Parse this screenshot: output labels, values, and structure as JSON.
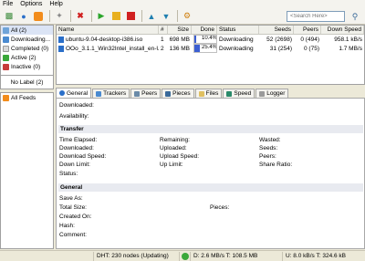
{
  "menu": [
    "File",
    "Options",
    "Help"
  ],
  "search": {
    "placeholder": "<Search Here>"
  },
  "categories": [
    {
      "label": "All (2)"
    },
    {
      "label": "Downloading..."
    },
    {
      "label": "Completed (0)"
    },
    {
      "label": "Active (2)"
    },
    {
      "label": "Inactive (0)"
    }
  ],
  "no_label": "No Label (2)",
  "all_feeds": "All Feeds",
  "columns": [
    "Name",
    "#",
    "Size",
    "Done",
    "Status",
    "Seeds",
    "Peers",
    "Down Speed"
  ],
  "torrents": [
    {
      "name": "ubuntu-9.04-desktop-i386.iso",
      "num": "1",
      "size": "698 MB",
      "done": "10.4%",
      "progress": 0.104,
      "status": "Downloading",
      "seeds": "52 (2698)",
      "peers": "0 (494)",
      "down": "958.1 kB/s"
    },
    {
      "name": "OOo_3.1.1_Win32Intel_install_en-U...",
      "num": "2",
      "size": "136 MB",
      "done": "25.4%",
      "progress": 0.254,
      "status": "Downloading",
      "seeds": "31 (254)",
      "peers": "0 (75)",
      "down": "1.7 MB/s"
    }
  ],
  "tabs": [
    "General",
    "Trackers",
    "Peers",
    "Pieces",
    "Files",
    "Speed",
    "Logger"
  ],
  "general": {
    "downloaded": "Downloaded:",
    "availability": "Availability:",
    "transfer_title": "Transfer",
    "time_elapsed": "Time Elapsed:",
    "remaining": "Remaining:",
    "wasted": "Wasted:",
    "downloaded2": "Downloaded:",
    "uploaded": "Uploaded:",
    "seeds": "Seeds:",
    "download_speed": "Download Speed:",
    "upload_speed": "Upload Speed:",
    "peers": "Peers:",
    "down_limit": "Down Limit:",
    "up_limit": "Up Limit:",
    "share_ratio": "Share Ratio:",
    "status": "Status:",
    "general_title": "General",
    "save_as": "Save As:",
    "total_size": "Total Size:",
    "pieces": "Pieces:",
    "created_on": "Created On:",
    "hash": "Hash:",
    "comment": "Comment:"
  },
  "statusbar": {
    "dht": "DHT: 230 nodes (Updating)",
    "down": "D: 2.6 MB/s T: 108.5 MB",
    "up": "U: 8.0 kB/s T: 324.6 kB"
  },
  "colors": {
    "accent": "#3c5fd2",
    "selected": "#dbe4f5",
    "ok": "#3aa83a"
  }
}
